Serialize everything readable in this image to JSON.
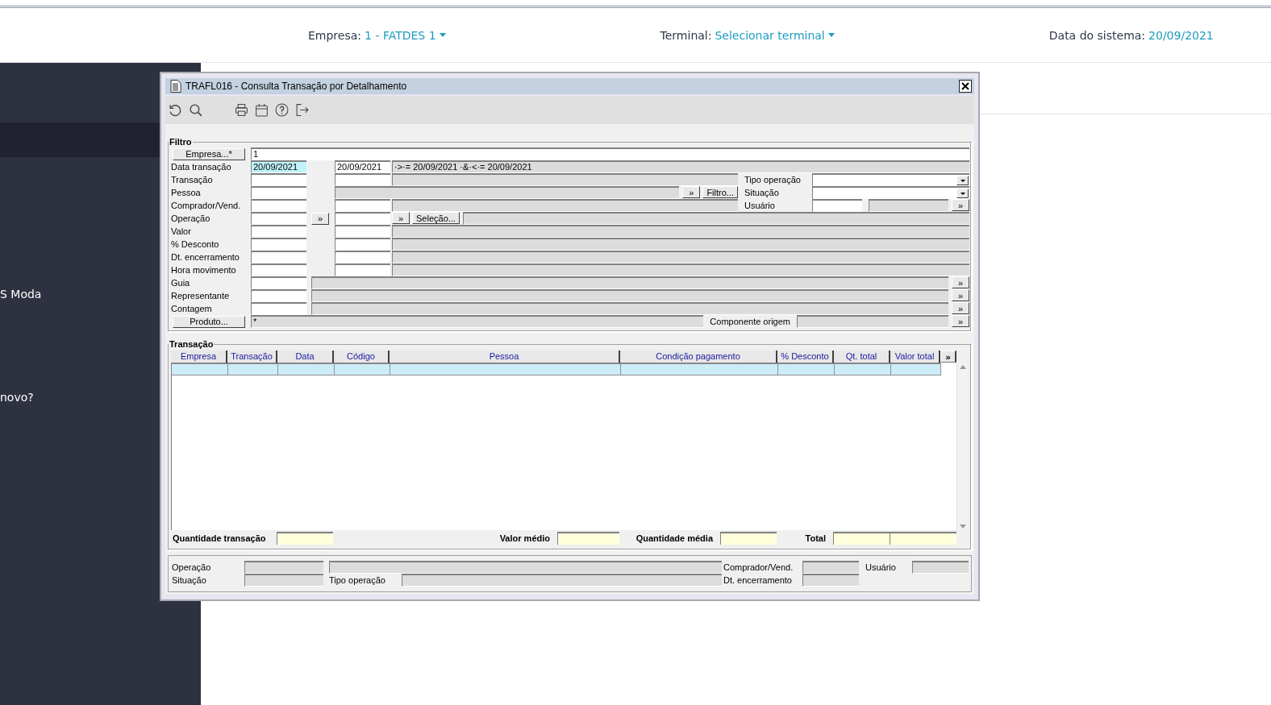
{
  "header": {
    "items": [
      {
        "label": "Empresa:",
        "value": "1 - FATDES 1",
        "dropdown": true
      },
      {
        "label": "Terminal:",
        "value": "Selecionar terminal",
        "dropdown": true
      },
      {
        "label": "Data do sistema:",
        "value": "20/09/2021",
        "dropdown": false
      }
    ]
  },
  "sidebar": {
    "items": [
      "S Moda",
      "novo?"
    ]
  },
  "dialog": {
    "title": "TRAFL016 - Consulta Transação por Detalhamento",
    "filter": {
      "title": "Filtro",
      "rows": [
        {
          "kind": "empresa",
          "button": "Empresa...*",
          "value": "1",
          "focused": false
        },
        {
          "kind": "range",
          "label": "Data transação",
          "from": "20/09/2021",
          "to": "20/09/2021",
          "description": "·>·= 20/09/2021 ·&·<·= 20/09/2021",
          "focused": true
        },
        {
          "kind": "range",
          "label": "Transação",
          "focused": false,
          "side": {
            "kind": "combo",
            "label": "Tipo operação"
          }
        },
        {
          "kind": "lookup",
          "label": "Pessoa",
          "focused": false,
          "buttons": [
            {
              "kind": "lookup",
              "text": "»"
            },
            {
              "kind": "action",
              "text": "Filtro..."
            }
          ],
          "side": {
            "kind": "combo",
            "label": "Situação"
          }
        },
        {
          "kind": "range",
          "label": "Comprador/Vend.",
          "focused": false,
          "side": {
            "kind": "lookup",
            "label": "Usuário",
            "button": "»"
          }
        },
        {
          "kind": "range_buttons",
          "label": "Operação",
          "focused": false,
          "mid_button": "»",
          "buttons": [
            {
              "kind": "lookup",
              "text": "»"
            },
            {
              "kind": "action",
              "text": "Seleção..."
            }
          ]
        },
        {
          "kind": "range",
          "label": "Valor",
          "focused": false
        },
        {
          "kind": "range",
          "label": "% Desconto",
          "focused": false
        },
        {
          "kind": "range",
          "label": "Dt. encerramento",
          "focused": false
        },
        {
          "kind": "range",
          "label": "Hora movimento",
          "focused": false
        },
        {
          "kind": "single",
          "label": "Guia",
          "button": "»",
          "focused": false
        },
        {
          "kind": "single",
          "label": "Representante",
          "button": "»",
          "focused": false
        },
        {
          "kind": "single",
          "label": "Contagem",
          "button": "»",
          "focused": false
        },
        {
          "kind": "produto",
          "button": "Produto...",
          "value": "*",
          "extra_label": "Componente origem",
          "extra_button": "»",
          "focused": false
        }
      ]
    },
    "transactions": {
      "title": "Transação",
      "columns": [
        "Empresa",
        "Transação",
        "Data",
        "Código",
        "Pessoa",
        "Condição pagamento",
        "% Desconto",
        "Qt. total",
        "Valor total"
      ],
      "more_button": "»",
      "rows": [
        {
          "selected": true
        }
      ],
      "totals": [
        {
          "label": "Quantidade transação",
          "kind": "single"
        },
        {
          "label": "Valor médio",
          "kind": "single"
        },
        {
          "label": "Quantidade média",
          "kind": "single"
        },
        {
          "label": "Total",
          "kind": "pair"
        }
      ]
    },
    "details": {
      "rows": [
        {
          "label": "Operação",
          "middle": {
            "kind": "field"
          },
          "side_label": "Comprador/Vend.",
          "extra_label": "Usuário"
        },
        {
          "label": "Situação",
          "middle": {
            "kind": "labeled",
            "label": "Tipo operação"
          },
          "side_label": "Dt. encerramento"
        }
      ]
    }
  }
}
